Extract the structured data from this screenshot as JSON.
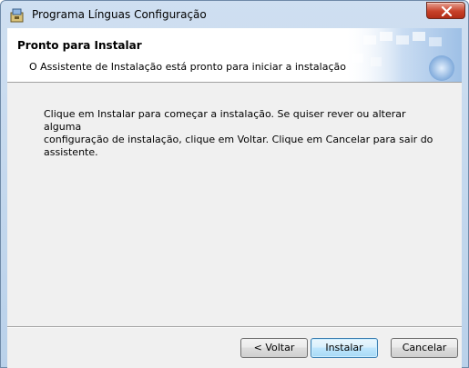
{
  "window": {
    "title": "Programa Línguas Configuração",
    "close_label": "x"
  },
  "banner": {
    "title": "Pronto para Instalar",
    "subtitle": "O Assistente de Instalação está pronto para iniciar a instalação"
  },
  "body": {
    "line1": "Clique em Instalar para começar a instalação.  Se quiser rever ou alterar alguma",
    "line2": "configuração de instalação, clique em Voltar. Clique em Cancelar para sair do assistente."
  },
  "buttons": {
    "back": "< Voltar",
    "install": "Instalar",
    "cancel": "Cancelar"
  },
  "colors": {
    "titlebar": "#c4d8ee",
    "close_button": "#c7422a",
    "client_background": "#f0f0f0",
    "default_button_border": "#3c7fb1"
  }
}
